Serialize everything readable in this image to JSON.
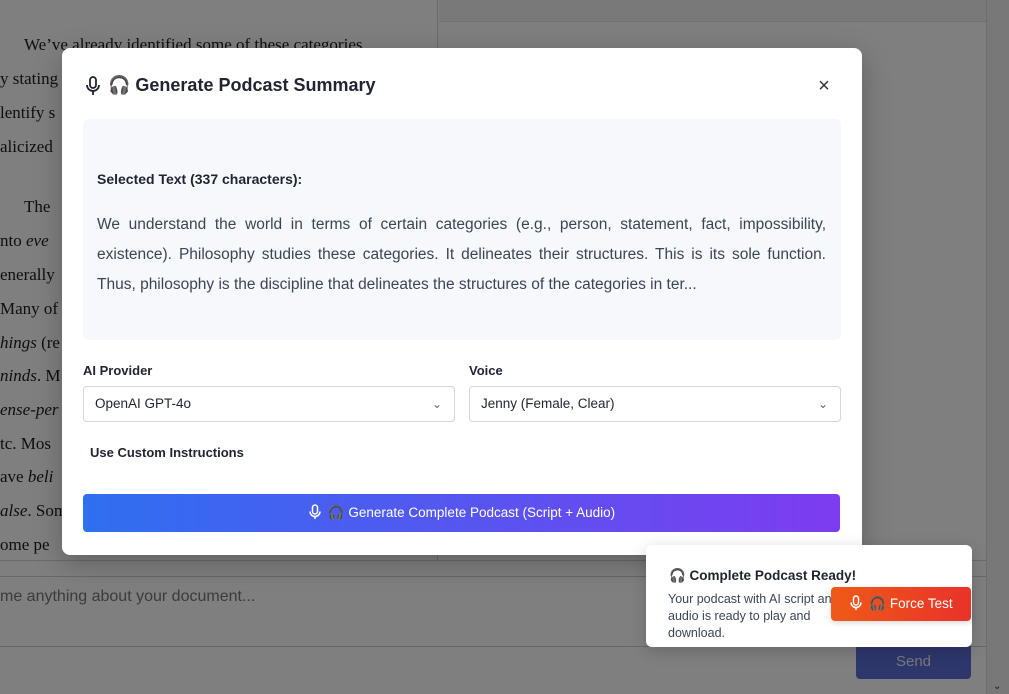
{
  "background_document": {
    "lines": [
      {
        "text": "We’ve already identified some of these categories",
        "italic": ""
      },
      {
        "text": "y stating",
        "italic": ""
      },
      {
        "text": "lentify s",
        "italic": ""
      },
      {
        "text": "alicized",
        "italic": ""
      },
      {
        "text": "The",
        "italic": ""
      },
      {
        "text": "nto ",
        "italic": "eve"
      },
      {
        "text": "enerally",
        "italic": ""
      },
      {
        "text": "Many of",
        "italic": ""
      },
      {
        "text": " (re",
        "italic": "hings"
      },
      {
        "text": ". M",
        "italic": "ninds"
      },
      {
        "text": "",
        "italic": "ense-per"
      },
      {
        "text": "tc. Mos",
        "italic": ""
      },
      {
        "text": "ave ",
        "italic": "beli"
      },
      {
        "text": ". Som",
        "italic": "alse"
      },
      {
        "text": "ome  pe",
        "italic": ""
      }
    ]
  },
  "chat": {
    "placeholder": "me anything about your document...",
    "send_label": "Send"
  },
  "modal": {
    "title": "🎧 Generate Podcast Summary",
    "close_label": "×",
    "selected_text_label": "Selected Text (337 characters):",
    "selected_text": "We understand the world in terms of certain categories (e.g., person, statement, fact, impossibility, existence). Philosophy studies these categories. It delineates their structures. This is its sole function. Thus, philosophy is the discipline that delineates the structures of the categories in ter...",
    "provider_label": "AI Provider",
    "provider_value": "OpenAI GPT-4o",
    "voice_label": "Voice",
    "voice_value": "Jenny (Female, Clear)",
    "custom_instructions_label": "Use Custom Instructions",
    "generate_label": "🎧 Generate Complete Podcast (Script + Audio)"
  },
  "toast": {
    "title": "🎧 Complete Podcast Ready!",
    "body": "Your podcast with AI script and audio is ready to play and download.",
    "force_label": "🎧 Force Test"
  },
  "icons": {
    "mic": "microphone-icon",
    "close": "close-icon",
    "chevron": "chevron-down-icon"
  },
  "colors": {
    "gradient_start": "#2f6ff0",
    "gradient_end": "#7d3cf0",
    "force_start": "#ef5a18",
    "force_end": "#e8322a"
  }
}
